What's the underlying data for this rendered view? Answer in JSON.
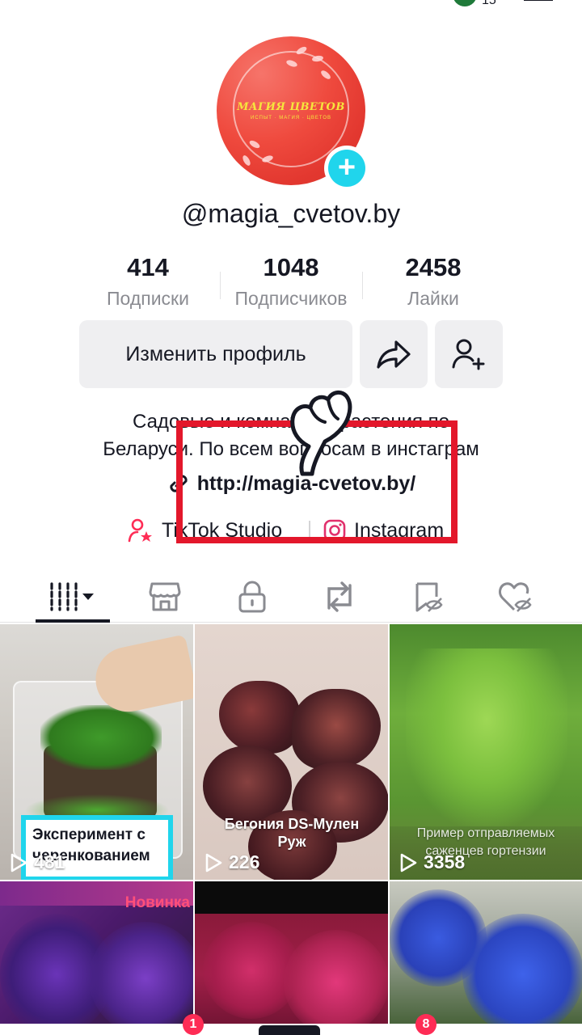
{
  "status_bar": {
    "badge_count": "15"
  },
  "profile": {
    "avatar_title": "МАГИЯ ЦВЕТОВ",
    "avatar_subtitle": "ИСПЫТ · МАГИЯ · ЦВЕТОВ",
    "username": "@magia_cvetov.by"
  },
  "stats": [
    {
      "value": "414",
      "label": "Подписки"
    },
    {
      "value": "1048",
      "label": "Подписчиков"
    },
    {
      "value": "2458",
      "label": "Лайки"
    }
  ],
  "actions": {
    "edit_label": "Изменить профиль"
  },
  "bio": {
    "line1": "Садовые и комнатные растения по",
    "line2": "Беларуси. По всем вопросам в инстаграм",
    "link": "http://magia-cvetov.by/"
  },
  "chips": {
    "studio": "TikTok Studio",
    "instagram": "Instagram"
  },
  "videos": [
    {
      "caption": "Эксперимент с черенкованием",
      "views": "481"
    },
    {
      "caption": "Бегония DS-Мулен Руж",
      "views": "226"
    },
    {
      "caption": "Пример отправляемых саженцев гортензии",
      "views": "3358"
    },
    {
      "caption": "Новинка",
      "views": ""
    },
    {
      "caption": "",
      "views": ""
    },
    {
      "caption": "",
      "views": ""
    }
  ],
  "bottom_bar": {
    "inbox_badge": "1",
    "messages_badge": "8"
  },
  "colors": {
    "accent": "#fe2c55",
    "highlight": "#e3172b",
    "teal": "#20d5ec"
  }
}
